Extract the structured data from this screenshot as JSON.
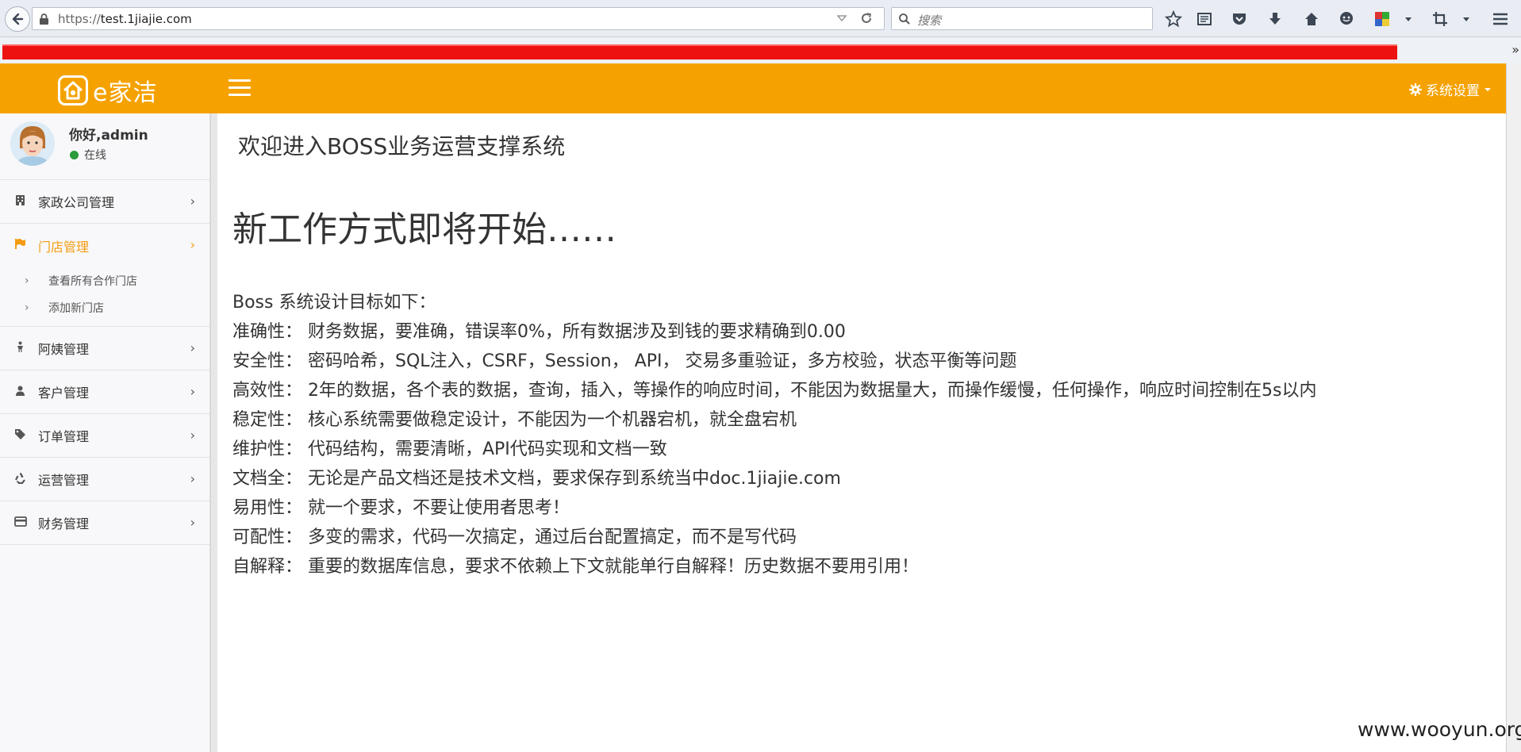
{
  "browser": {
    "url_scheme": "https://",
    "url_host": "test.1jiajie.com",
    "search_placeholder": "搜索"
  },
  "app": {
    "logo_text": "e家洁",
    "settings_label": "系统设置",
    "accent_color": "#f5a200"
  },
  "user": {
    "greeting": "你好,admin",
    "status": "在线"
  },
  "sidebar": {
    "items": [
      {
        "label": "家政公司管理",
        "icon": "building-icon"
      },
      {
        "label": "门店管理",
        "icon": "flag-icon",
        "active": true
      },
      {
        "label": "阿姨管理",
        "icon": "person-icon"
      },
      {
        "label": "客户管理",
        "icon": "user-icon"
      },
      {
        "label": "订单管理",
        "icon": "tag-icon"
      },
      {
        "label": "运营管理",
        "icon": "recycle-icon"
      },
      {
        "label": "财务管理",
        "icon": "credit-card-icon"
      }
    ],
    "store_submenu": [
      "查看所有合作门店",
      "添加新门店"
    ]
  },
  "content": {
    "title": "欢迎进入BOSS业务运营支撑系统",
    "headline": "新工作方式即将开始……",
    "intro": "Boss 系统设计目标如下：",
    "goals": [
      "准确性： 财务数据，要准确，错误率0%，所有数据涉及到钱的要求精确到0.00",
      "安全性： 密码哈希，SQL注入，CSRF，Session， API， 交易多重验证，多方校验，状态平衡等问题",
      "高效性： 2年的数据，各个表的数据，查询，插入，等操作的响应时间，不能因为数据量大，而操作缓慢，任何操作，响应时间控制在5s以内",
      "稳定性： 核心系统需要做稳定设计，不能因为一个机器宕机，就全盘宕机",
      "维护性： 代码结构，需要清晰，API代码实现和文档一致",
      "文档全： 无论是产品文档还是技术文档，要求保存到系统当中doc.1jiajie.com",
      "易用性： 就一个要求，不要让使用者思考！",
      "可配性： 多变的需求，代码一次搞定，通过后台配置搞定，而不是写代码",
      "自解释： 重要的数据库信息，要求不依赖上下文就能单行自解释！历史数据不要用引用！"
    ]
  },
  "watermark": "www.wooyun.org"
}
